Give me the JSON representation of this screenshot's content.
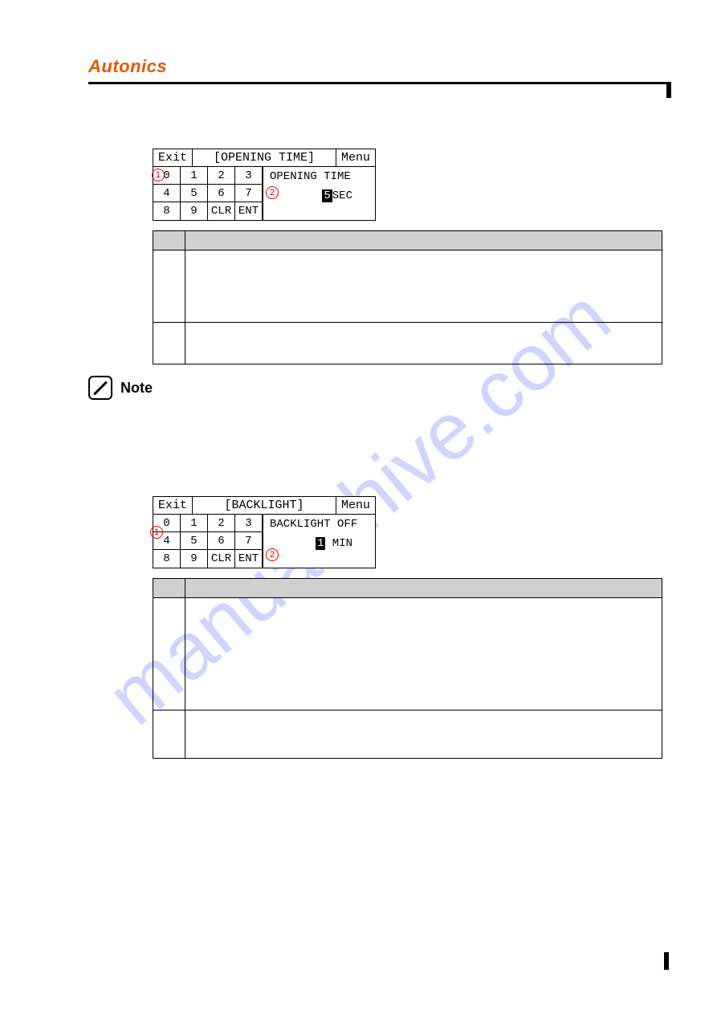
{
  "brand": "Autonics",
  "watermark": "manualshive.com",
  "note_label": "Note",
  "lcd1": {
    "exit": "Exit",
    "title": "[OPENING TIME]",
    "menu": "Menu",
    "keys": [
      "0",
      "1",
      "2",
      "3",
      "4",
      "5",
      "6",
      "7",
      "8",
      "9",
      "CLR",
      "ENT"
    ],
    "label": "OPENING TIME",
    "value_num": "5",
    "value_unit": "SEC",
    "marker1": "1",
    "marker2": "2"
  },
  "lcd2": {
    "exit": "Exit",
    "title": "[BACKLIGHT]",
    "menu": "Menu",
    "keys": [
      "0",
      "1",
      "2",
      "3",
      "4",
      "5",
      "6",
      "7",
      "8",
      "9",
      "CLR",
      "ENT"
    ],
    "label": "BACKLIGHT OFF",
    "value_num": "1",
    "value_unit": " MIN",
    "marker1": "1",
    "marker2": "2"
  }
}
